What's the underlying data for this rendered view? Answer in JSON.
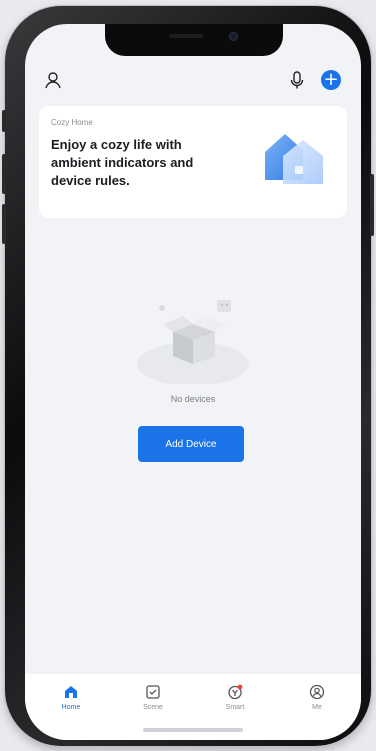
{
  "banner": {
    "subtitle": "Cozy Home",
    "title": "Enjoy a cozy life with ambient indicators and device rules."
  },
  "empty_state": {
    "message": "No devices",
    "add_device_label": "Add Device"
  },
  "tabs": [
    {
      "label": "Home",
      "icon": "home-icon",
      "active": true
    },
    {
      "label": "Scene",
      "icon": "scene-icon",
      "active": false
    },
    {
      "label": "Smart",
      "icon": "smart-icon",
      "active": false,
      "badge": true
    },
    {
      "label": "Me",
      "icon": "me-icon",
      "active": false
    }
  ],
  "colors": {
    "accent": "#1a73e8",
    "background": "#f2f3f7",
    "badge": "#e8453c"
  },
  "icons": {
    "top_left": "user-icon",
    "top_right_1": "microphone-icon",
    "top_right_2": "add-icon"
  }
}
